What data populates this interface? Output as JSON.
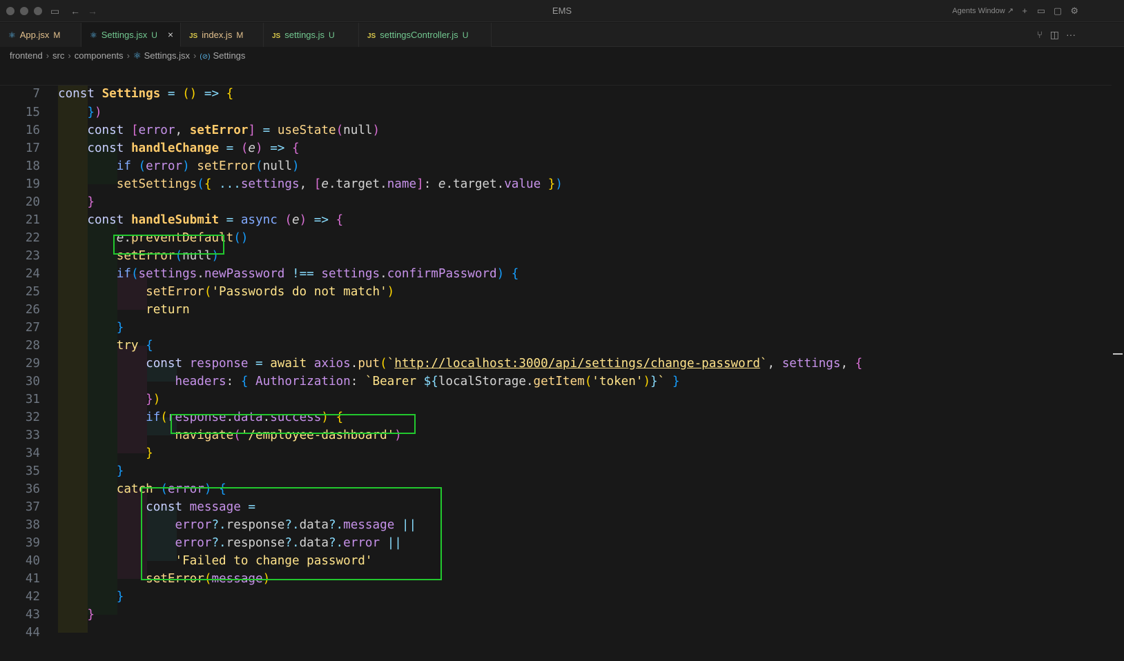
{
  "window": {
    "title": "EMS",
    "agents_label": "Agents Window ↗"
  },
  "tabs": [
    {
      "name": "App.jsx",
      "status": "M",
      "icon": "react-icon",
      "state": "mod"
    },
    {
      "name": "Settings.jsx",
      "status": "U",
      "icon": "react-icon",
      "state": "unt",
      "active": true
    },
    {
      "name": "index.js",
      "status": "M",
      "icon": "js-icon",
      "state": "mod"
    },
    {
      "name": "settings.js",
      "status": "U",
      "icon": "js-icon",
      "state": "unt"
    },
    {
      "name": "settingsController.js",
      "status": "U",
      "icon": "js-icon",
      "state": "unt"
    }
  ],
  "breadcrumb": [
    "frontend",
    "src",
    "components",
    "Settings.jsx",
    "Settings"
  ],
  "icons": {
    "tab_file": "⚛",
    "js_badge": "JS",
    "close": "×",
    "symbol": "(⊘)"
  },
  "code": {
    "sticky_line": "7",
    "lines": [
      "15",
      "16",
      "17",
      "18",
      "19",
      "20",
      "21",
      "22",
      "23",
      "24",
      "25",
      "26",
      "27",
      "28",
      "29",
      "30",
      "31",
      "32",
      "33",
      "34",
      "35",
      "36",
      "37",
      "38",
      "39",
      "40",
      "41",
      "42",
      "43",
      "44"
    ]
  },
  "colors": {
    "background": "#181818",
    "highlight_box": "#22c82e",
    "modified": "#e2c08d",
    "untracked": "#73c991"
  }
}
